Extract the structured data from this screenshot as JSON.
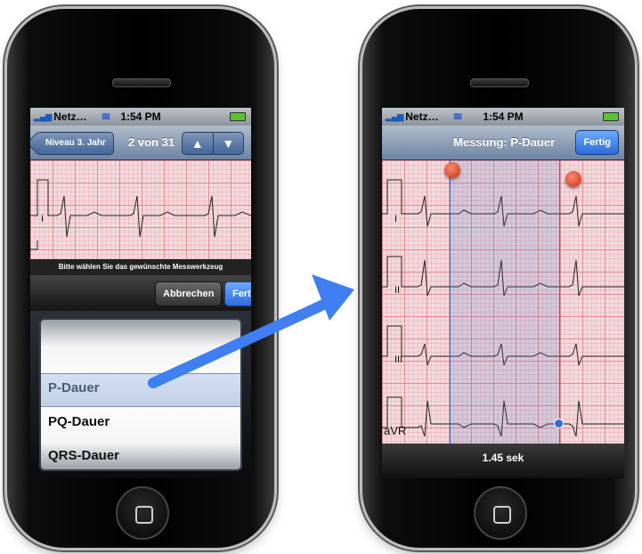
{
  "left_phone": {
    "status": {
      "carrier": "Netz…",
      "time": "1:54 PM"
    },
    "navbar": {
      "back_label": "Niveau 3. Jahr",
      "title": "2 von 31",
      "up_arrow": "▲",
      "down_arrow": "▼"
    },
    "ecg": {
      "lead": "I"
    },
    "tool_prompt": "Bitte wählen Sie das gewünschte Messwerkzeug",
    "toolbar": {
      "cancel_label": "Abbrechen",
      "done_label": "Fertig"
    },
    "picker": {
      "items": [
        "P-Dauer",
        "PQ-Dauer",
        "QRS-Dauer"
      ],
      "selected": "P-Dauer"
    }
  },
  "right_phone": {
    "status": {
      "carrier": "Netz…",
      "time": "1:54 PM"
    },
    "navbar": {
      "title": "Messung: P-Dauer",
      "done_label": "Fertig"
    },
    "ecg": {
      "leads": [
        "I",
        "II",
        "III",
        "aVR"
      ]
    },
    "measurement": "1.45 sek"
  },
  "colors": {
    "arrow": "#3f7ff2",
    "nav": "#6d84a2",
    "button": "#2e6ddd",
    "grid": "#f4d9dc",
    "caliper": "#3d6fd0"
  }
}
